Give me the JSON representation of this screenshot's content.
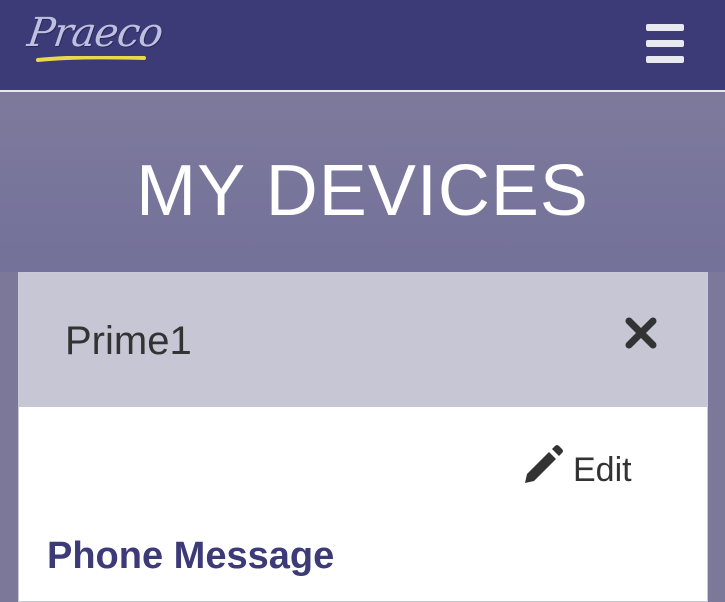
{
  "brand": {
    "logo_text": "Praeco"
  },
  "navbar": {
    "menu_icon": "hamburger-menu-icon"
  },
  "page": {
    "title": "MY DEVICES"
  },
  "device_card": {
    "device_name": "Prime1",
    "close_icon": "close-x-icon",
    "edit_label": "Edit",
    "edit_icon": "pencil-icon",
    "section_heading": "Phone Message"
  },
  "colors": {
    "navbar": "#3d3a78",
    "page_background": "#7b789a",
    "card_header": "#c7c6d4",
    "heading_accent": "#3d3a78"
  }
}
